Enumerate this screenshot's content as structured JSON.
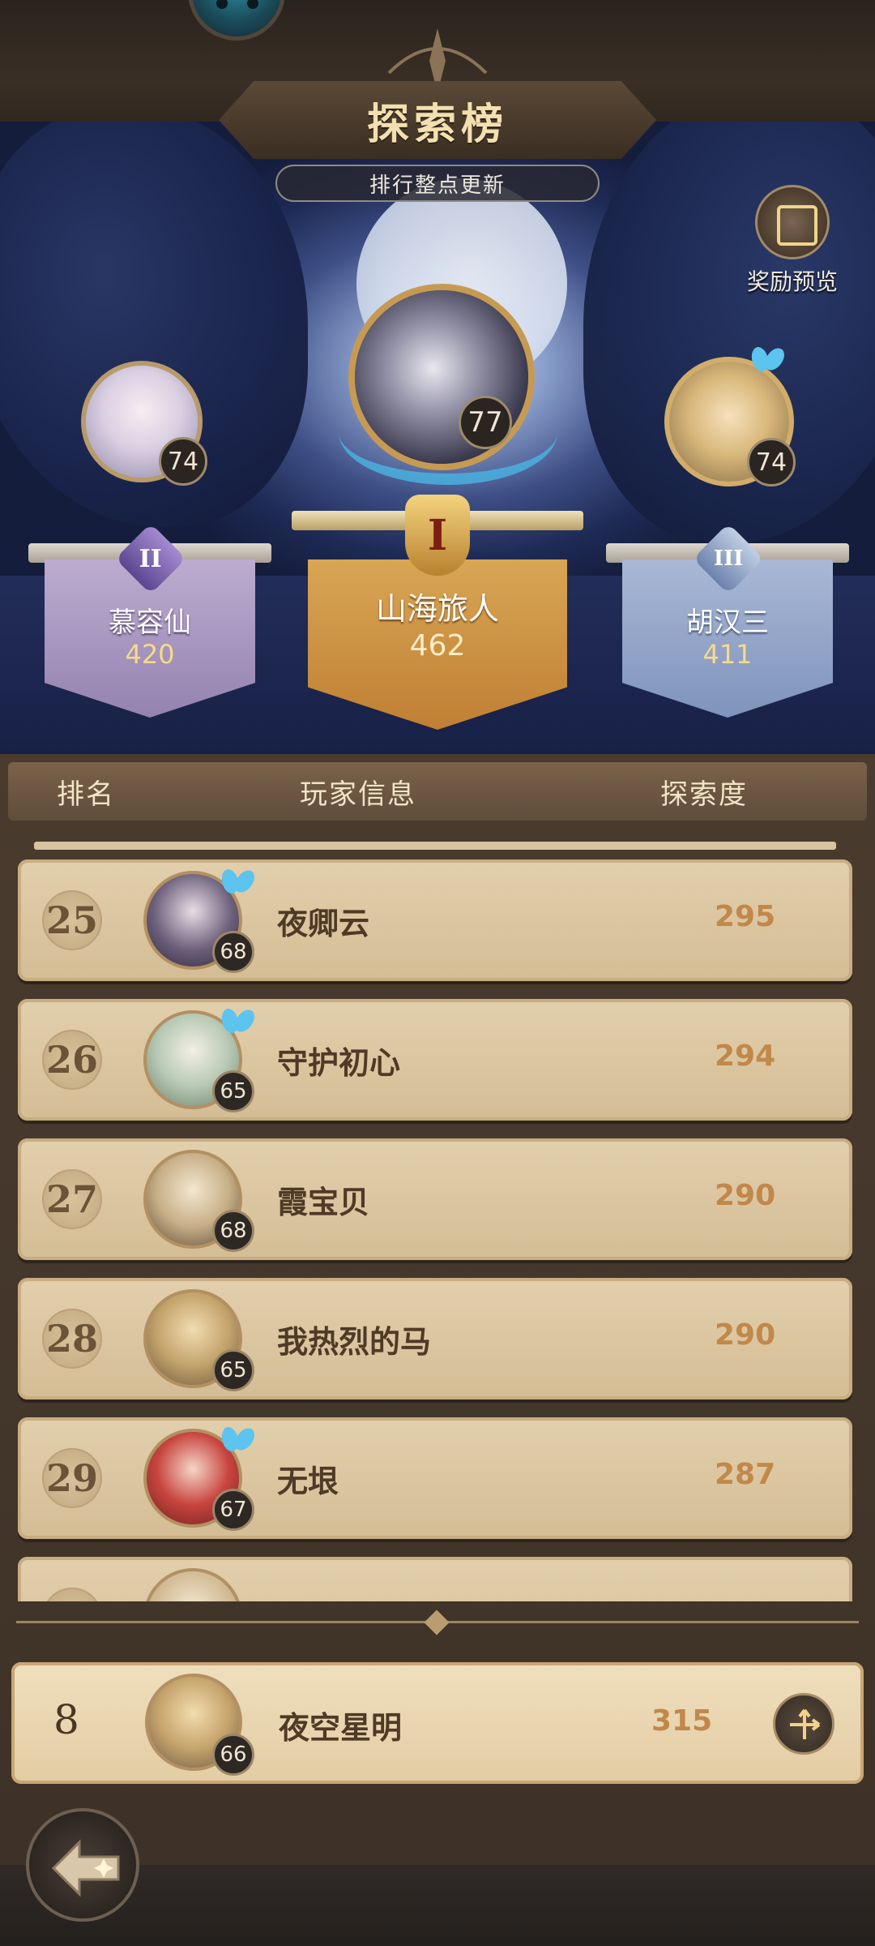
{
  "header": {
    "title": "探索榜",
    "subtitle": "排行整点更新",
    "reward_preview_label": "奖励预览"
  },
  "podium": {
    "first": {
      "rank_badge": "I",
      "name": "山海旅人",
      "score": "462",
      "level": "77"
    },
    "second": {
      "rank_badge": "II",
      "name": "慕容仙",
      "score": "420",
      "level": "74"
    },
    "third": {
      "rank_badge": "III",
      "name": "胡汉三",
      "score": "411",
      "level": "74"
    }
  },
  "table": {
    "columns": [
      "排名",
      "玩家信息",
      "探索度"
    ],
    "rows": [
      {
        "rank": "25",
        "name": "夜卿云",
        "level": "68",
        "score": "295"
      },
      {
        "rank": "26",
        "name": "守护初心",
        "level": "65",
        "score": "294"
      },
      {
        "rank": "27",
        "name": "霞宝贝",
        "level": "68",
        "score": "290"
      },
      {
        "rank": "28",
        "name": "我热烈的马",
        "level": "65",
        "score": "290"
      },
      {
        "rank": "29",
        "name": "无垠",
        "level": "67",
        "score": "287"
      }
    ]
  },
  "my_entry": {
    "rank": "8",
    "name": "夜空星明",
    "level": "66",
    "score": "315"
  },
  "icons": {
    "reward": "reward-chest-icon",
    "locate": "locate-arrows-icon",
    "back": "back-arrow-icon"
  }
}
